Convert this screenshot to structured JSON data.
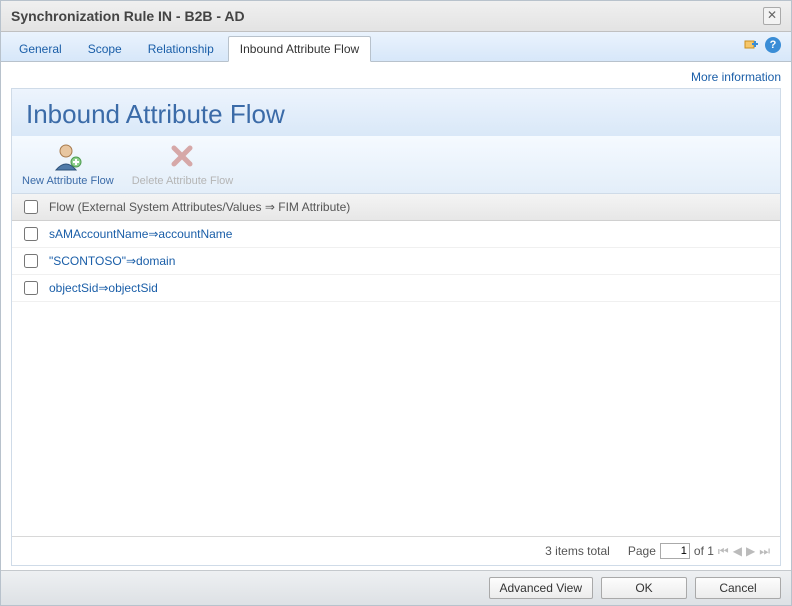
{
  "title": "Synchronization Rule IN - B2B - AD",
  "tabs": [
    "General",
    "Scope",
    "Relationship",
    "Inbound Attribute Flow"
  ],
  "activeTab": "Inbound Attribute Flow",
  "moreInfo": "More information",
  "panelTitle": "Inbound Attribute Flow",
  "toolbar": {
    "newLabel": "New Attribute Flow",
    "deleteLabel": "Delete Attribute Flow"
  },
  "columnHeader": "Flow (External System Attributes/Values ⇒ FIM Attribute)",
  "rows": [
    {
      "text": "sAMAccountName⇒accountName"
    },
    {
      "text": "\"SCONTOSO\"⇒domain"
    },
    {
      "text": "objectSid⇒objectSid"
    }
  ],
  "footer": {
    "itemsTotal": "3 items total",
    "pageLabel": "Page",
    "pageCurrent": "1",
    "pageOf": "of 1"
  },
  "buttons": {
    "advanced": "Advanced View",
    "ok": "OK",
    "cancel": "Cancel"
  }
}
